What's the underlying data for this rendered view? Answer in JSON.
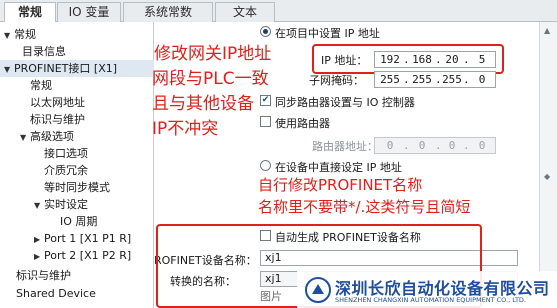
{
  "tabs": [
    "常规",
    "IO 变量",
    "系统常数",
    "文本"
  ],
  "tree": {
    "items": [
      {
        "label": "常规",
        "arrow": "▼"
      },
      {
        "label": "目录信息",
        "arrow": ""
      },
      {
        "label": "PROFINET接口 [X1]",
        "arrow": "▼"
      },
      {
        "label": "常规",
        "arrow": ""
      },
      {
        "label": "以太网地址",
        "arrow": ""
      },
      {
        "label": "标识与维护",
        "arrow": ""
      },
      {
        "label": "高级选项",
        "arrow": "▼"
      },
      {
        "label": "接口选项",
        "arrow": ""
      },
      {
        "label": "介质冗余",
        "arrow": ""
      },
      {
        "label": "等时同步模式",
        "arrow": ""
      },
      {
        "label": "实时设定",
        "arrow": "▼"
      },
      {
        "label": "IO 周期",
        "arrow": ""
      },
      {
        "label": "Port 1 [X1 P1 R]",
        "arrow": "▶"
      },
      {
        "label": "Port 2 [X1 P2 R]",
        "arrow": "▶"
      },
      {
        "label": "标识与维护",
        "arrow": ""
      },
      {
        "label": "Shared Device",
        "arrow": ""
      }
    ]
  },
  "ip_section": {
    "radio_set_in_project": "在项目中设置 IP 地址",
    "ip_label": "IP 地址：",
    "ip_octets": [
      "192",
      "168",
      "20",
      "5"
    ],
    "mask_label": "子网掩码：",
    "mask_octets": [
      "255",
      "255",
      "255",
      "0"
    ],
    "sync_router_label": "同步路由器设置与 IO 控制器",
    "use_router_label": "使用路由器",
    "router_addr_label": "路由器地址：",
    "router_octets": [
      "0",
      "0",
      "0",
      "0"
    ],
    "radio_direct_label": "在设备中直接设定 IP 地址"
  },
  "profinet_section": {
    "auto_generate_label": "自动生成 PROFINET设备名称",
    "device_name_label": "ROFINET设备名称：",
    "device_name_value": "xj1",
    "converted_name_label": "转换的名称：",
    "converted_name_value": "xj1"
  },
  "annotations": {
    "ip_note_1": "修改网关IP地址",
    "ip_note_2": "网段与PLC一致",
    "ip_note_3": "且与其他设备",
    "ip_note_4": "IP不冲突",
    "name_note_1": "自行修改PROFINET名称",
    "name_note_2": "名称里不要带*/.这类符号且简短"
  },
  "watermark": {
    "company_cn": "深圳长欣自动化设备有限公司",
    "company_en": "SHENZHEN CHANGXIN AUTOMATION EQUIPMENT CO., LTD.",
    "pic_label": "图片"
  },
  "colors": {
    "annotation_red": "#e0201b",
    "selection_blue": "#dde8f3",
    "watermark_blue": "#1e4ea0"
  }
}
